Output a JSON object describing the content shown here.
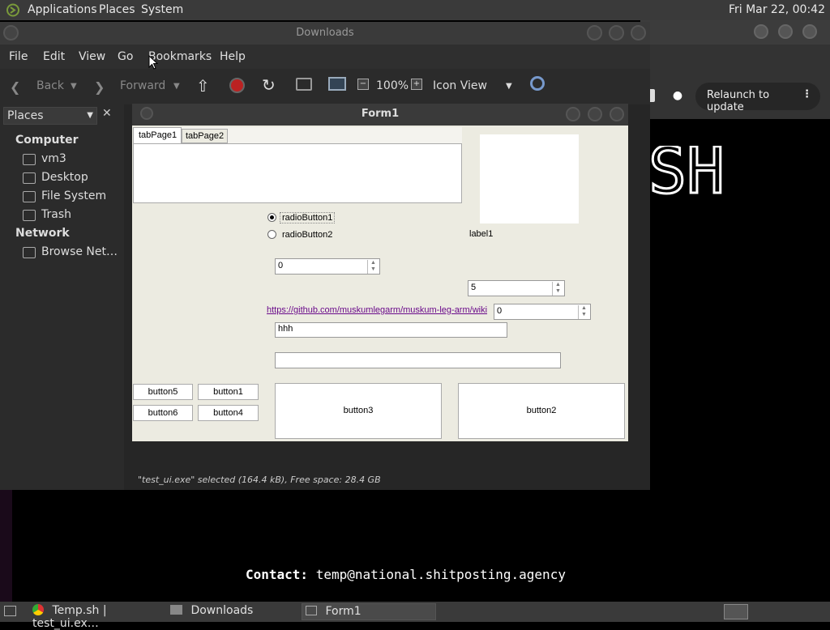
{
  "topbar": {
    "menu": [
      "Applications",
      "Places",
      "System"
    ],
    "clock": "Fri Mar 22, 00:42"
  },
  "background": {
    "relaunch_label": "Relaunch to update",
    "big_text": "SH",
    "contact_label": "Contact:",
    "contact_value": "temp@national.shitposting.agency"
  },
  "file_manager": {
    "title": "Downloads",
    "menu": [
      "File",
      "Edit",
      "View",
      "Go",
      "Bookmarks",
      "Help"
    ],
    "toolbar": {
      "back": "Back",
      "forward": "Forward",
      "zoom": "100%",
      "view_mode": "Icon View"
    },
    "sidebar": {
      "header": "Places",
      "sections": [
        {
          "title": "Computer",
          "items": [
            "vm3",
            "Desktop",
            "File System",
            "Trash"
          ]
        },
        {
          "title": "Network",
          "items": [
            "Browse Net…"
          ]
        }
      ]
    },
    "status": "\"test_ui.exe\" selected (164.4 kB), Free space: 28.4 GB"
  },
  "form1": {
    "title": "Form1",
    "tabs": [
      "tabPage1",
      "tabPage2"
    ],
    "radio1": "radioButton1",
    "radio2": "radioButton2",
    "label1": "label1",
    "spin1": "0",
    "spin2": "5",
    "spin3": "0",
    "link": "https://github.com/muskumlegarm/muskum-leg-arm/wiki",
    "textbox1": "hhh",
    "textbox2": "",
    "buttons": {
      "b5": "button5",
      "b1": "button1",
      "b6": "button6",
      "b4": "button4",
      "b3": "button3",
      "b2": "button2"
    }
  },
  "taskbar": {
    "tasks": [
      "Temp.sh | test_ui.ex…",
      "Downloads",
      "Form1"
    ]
  }
}
